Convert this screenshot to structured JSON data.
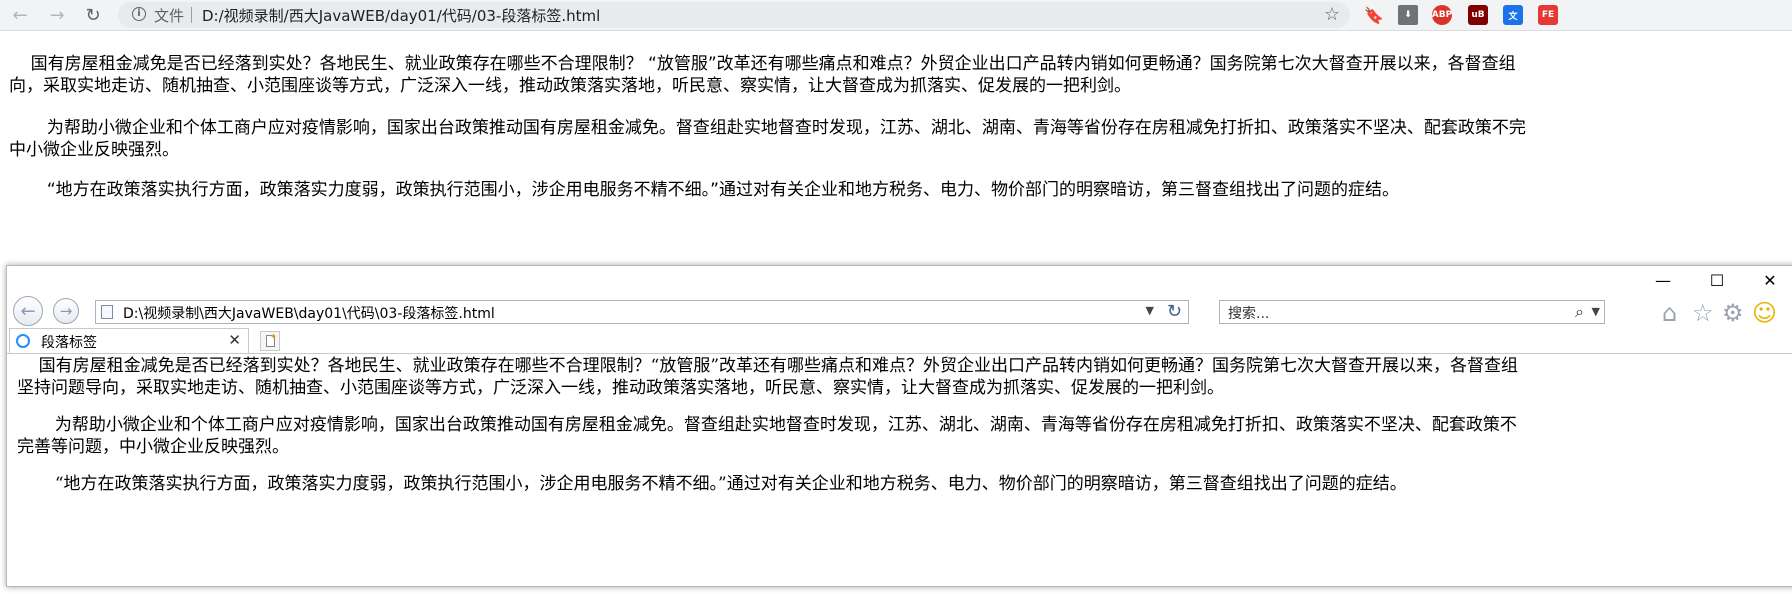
{
  "chrome": {
    "scheme_label": "文件",
    "url": "D:/视频录制/西大JavaWEB/day01/代码/03-段落标签.html",
    "extensions": [
      "ABP",
      "uB",
      "FE"
    ]
  },
  "paragraphs_chrome": [
    "    国有房屋租金减免是否已经落到实处？各地民生、就业政策存在哪些不合理限制？ “放管服”改革还有哪些痛点和难点？外贸企业出口产品转内销如何更畅通？国务院第七次大督查开展以来，各督查组",
    "向，采取实地走访、随机抽查、小范围座谈等方式，广泛深入一线，推动政策落实落地，听民意、察实情，让大督查成为抓落实、促发展的一把利剑。",
    "       为帮助小微企业和个体工商户应对疫情影响，国家出台政策推动国有房屋租金减免。督查组赴实地督查时发现，江苏、湖北、湖南、青海等省份存在房租减免打折扣、政策落实不坚决、配套政策不完",
    "中小微企业反映强烈。",
    "       “地方在政策落实执行方面，政策落实力度弱，政策执行范围小，涉企用电服务不精不细。”通过对有关企业和地方税务、电力、物价部门的明察暗访，第三督查组找出了问题的症结。"
  ],
  "ie": {
    "url": "D:\\视频录制\\西大JavaWEB\\day01\\代码\\03-段落标签.html",
    "search_placeholder": "搜索...",
    "tab_title": "段落标签"
  },
  "paragraphs_ie": [
    "    国有房屋租金减免是否已经落到实处？各地民生、就业政策存在哪些不合理限制？“放管服”改革还有哪些痛点和难点？外贸企业出口产品转内销如何更畅通？国务院第七次大督查开展以来，各督查组",
    "坚持问题导向，采取实地走访、随机抽查、小范围座谈等方式，广泛深入一线，推动政策落实落地，听民意、察实情，让大督查成为抓落实、促发展的一把利剑。",
    "       为帮助小微企业和个体工商户应对疫情影响，国家出台政策推动国有房屋租金减免。督查组赴实地督查时发现，江苏、湖北、湖南、青海等省份存在房租减免打折扣、政策落实不坚决、配套政策不",
    "完善等问题，中小微企业反映强烈。",
    "       “地方在政策落实执行方面，政策落实力度弱，政策执行范围小，涉企用电服务不精不细。”通过对有关企业和地方税务、电力、物价部门的明察暗访，第三督查组找出了问题的症结。"
  ]
}
